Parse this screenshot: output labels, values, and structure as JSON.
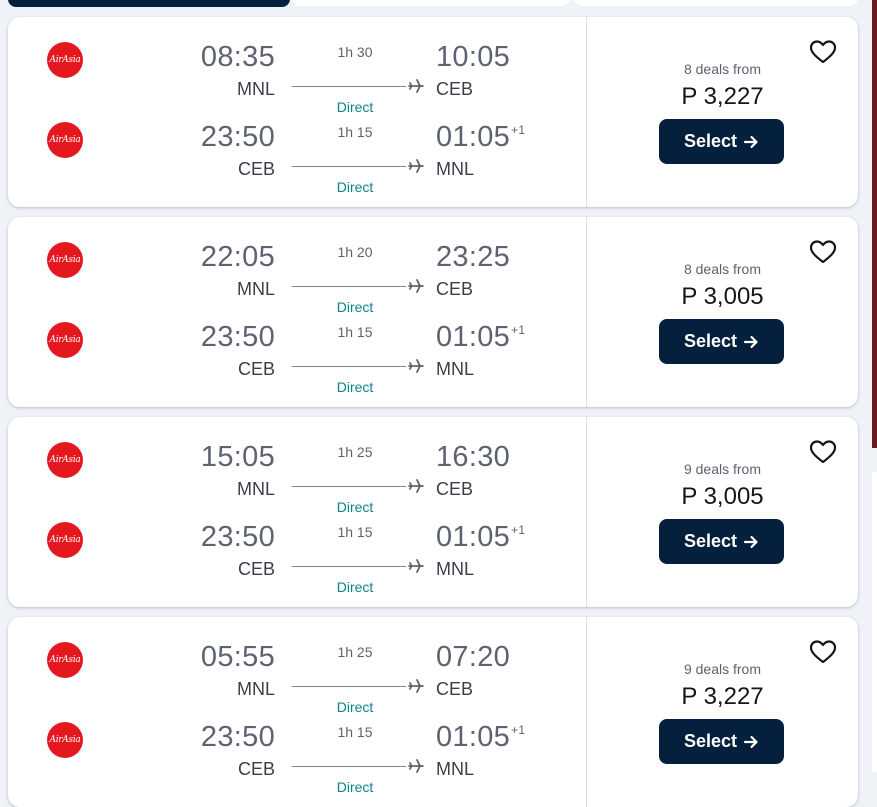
{
  "colors": {
    "accent": "#05203c",
    "direct": "#0c838a",
    "airline_logo": "#e3191f"
  },
  "airline_logo_text": "AirAsia",
  "cards": [
    {
      "outbound": {
        "dep": "08:35",
        "dep_code": "MNL",
        "duration": "1h 30",
        "stops": "Direct",
        "arr": "10:05",
        "arr_code": "CEB",
        "plus": ""
      },
      "return": {
        "dep": "23:50",
        "dep_code": "CEB",
        "duration": "1h 15",
        "stops": "Direct",
        "arr": "01:05",
        "arr_code": "MNL",
        "plus": "+1"
      },
      "deals": "8 deals from",
      "price": "P 3,227",
      "select_label": "Select"
    },
    {
      "outbound": {
        "dep": "22:05",
        "dep_code": "MNL",
        "duration": "1h 20",
        "stops": "Direct",
        "arr": "23:25",
        "arr_code": "CEB",
        "plus": ""
      },
      "return": {
        "dep": "23:50",
        "dep_code": "CEB",
        "duration": "1h 15",
        "stops": "Direct",
        "arr": "01:05",
        "arr_code": "MNL",
        "plus": "+1"
      },
      "deals": "8 deals from",
      "price": "P 3,005",
      "select_label": "Select"
    },
    {
      "outbound": {
        "dep": "15:05",
        "dep_code": "MNL",
        "duration": "1h 25",
        "stops": "Direct",
        "arr": "16:30",
        "arr_code": "CEB",
        "plus": ""
      },
      "return": {
        "dep": "23:50",
        "dep_code": "CEB",
        "duration": "1h 15",
        "stops": "Direct",
        "arr": "01:05",
        "arr_code": "MNL",
        "plus": "+1"
      },
      "deals": "9 deals from",
      "price": "P 3,005",
      "select_label": "Select"
    },
    {
      "outbound": {
        "dep": "05:55",
        "dep_code": "MNL",
        "duration": "1h 25",
        "stops": "Direct",
        "arr": "07:20",
        "arr_code": "CEB",
        "plus": ""
      },
      "return": {
        "dep": "23:50",
        "dep_code": "CEB",
        "duration": "1h 15",
        "stops": "Direct",
        "arr": "01:05",
        "arr_code": "MNL",
        "plus": "+1"
      },
      "deals": "9 deals from",
      "price": "P 3,227",
      "select_label": "Select"
    }
  ]
}
